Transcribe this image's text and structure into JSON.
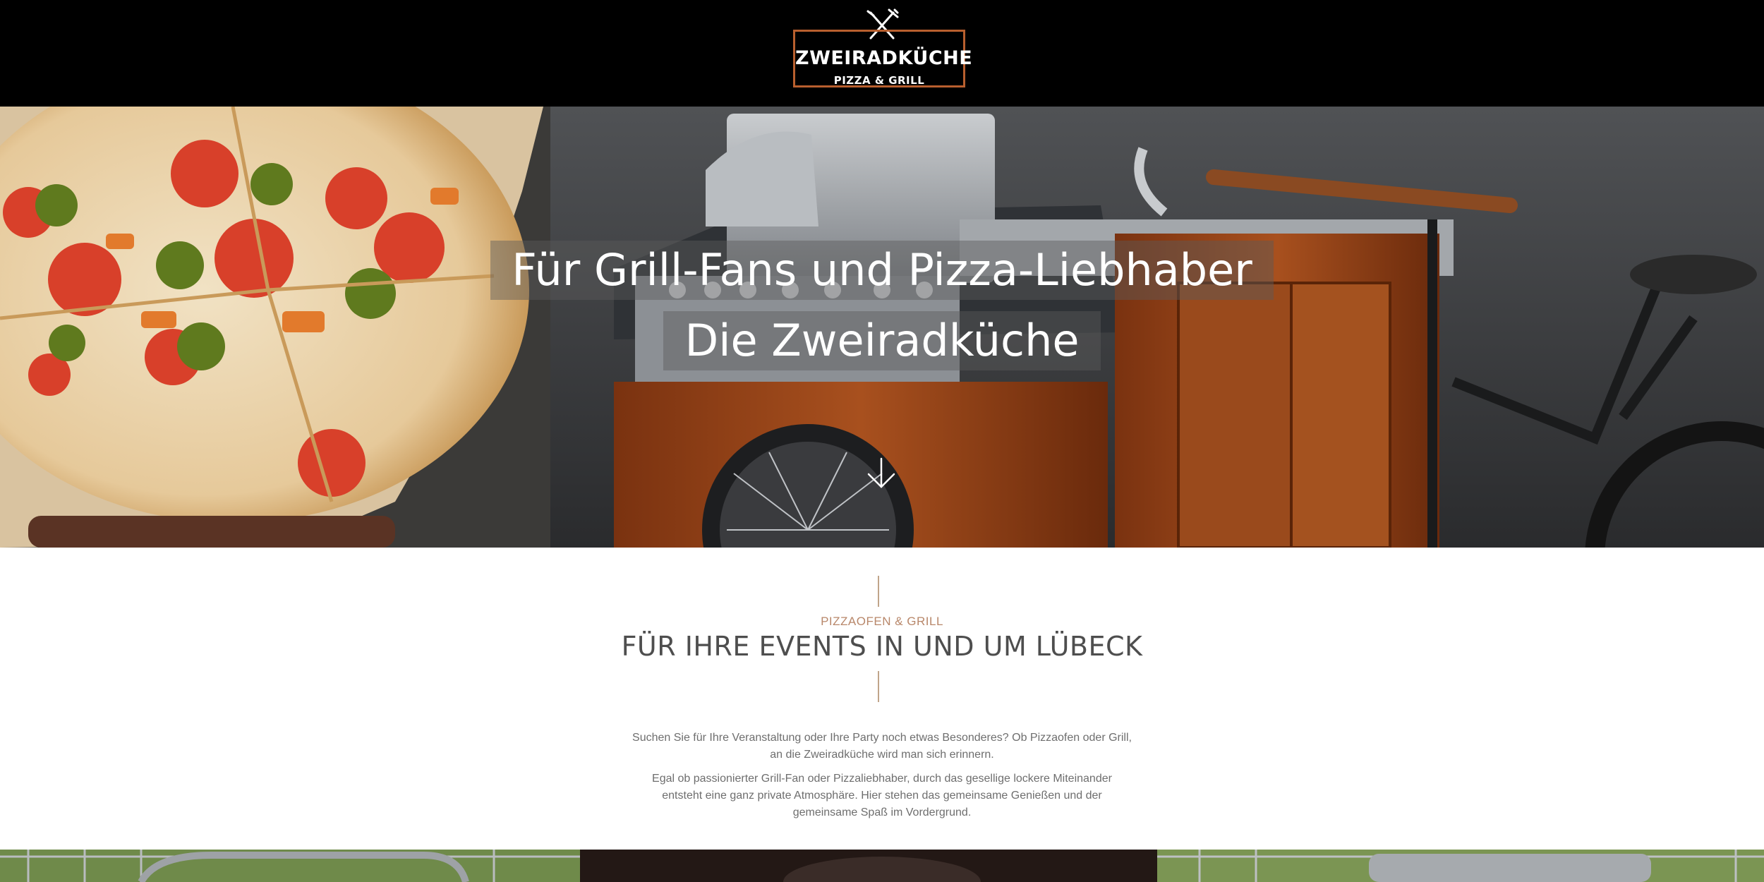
{
  "header": {
    "logo_name": "ZWEIRADKÜCHE",
    "logo_sub": "PIZZA & GRILL",
    "logo_border_color": "#b85f2e",
    "logo_icon": "fork-knife-icon"
  },
  "hero": {
    "title_line_1": "Für Grill-Fans und Pizza-Liebhaber",
    "title_line_2": "Die Zweiradküche",
    "scroll_icon": "arrow-down-icon"
  },
  "intro": {
    "eyebrow": "PIZZAOFEN & GRILL",
    "title": "FÜR IHRE EVENTS IN UND UM LÜBECK",
    "accent_color": "#b8876a",
    "paragraph_1_line_1": "Suchen Sie für Ihre Veranstaltung oder Ihre Party noch etwas Besonderes? Ob Pizzaofen oder Grill,",
    "paragraph_1_line_2": "an die Zweiradküche wird man sich erinnern.",
    "paragraph_2_line_1": "Egal ob passionierter Grill-Fan oder Pizzaliebhaber, durch das gesellige lockere Miteinander",
    "paragraph_2_line_2": "entsteht eine ganz private Atmosphäre. Hier stehen das gemeinsame Genießen und der",
    "paragraph_2_line_3": "gemeinsame Spaß im Vordergrund."
  }
}
